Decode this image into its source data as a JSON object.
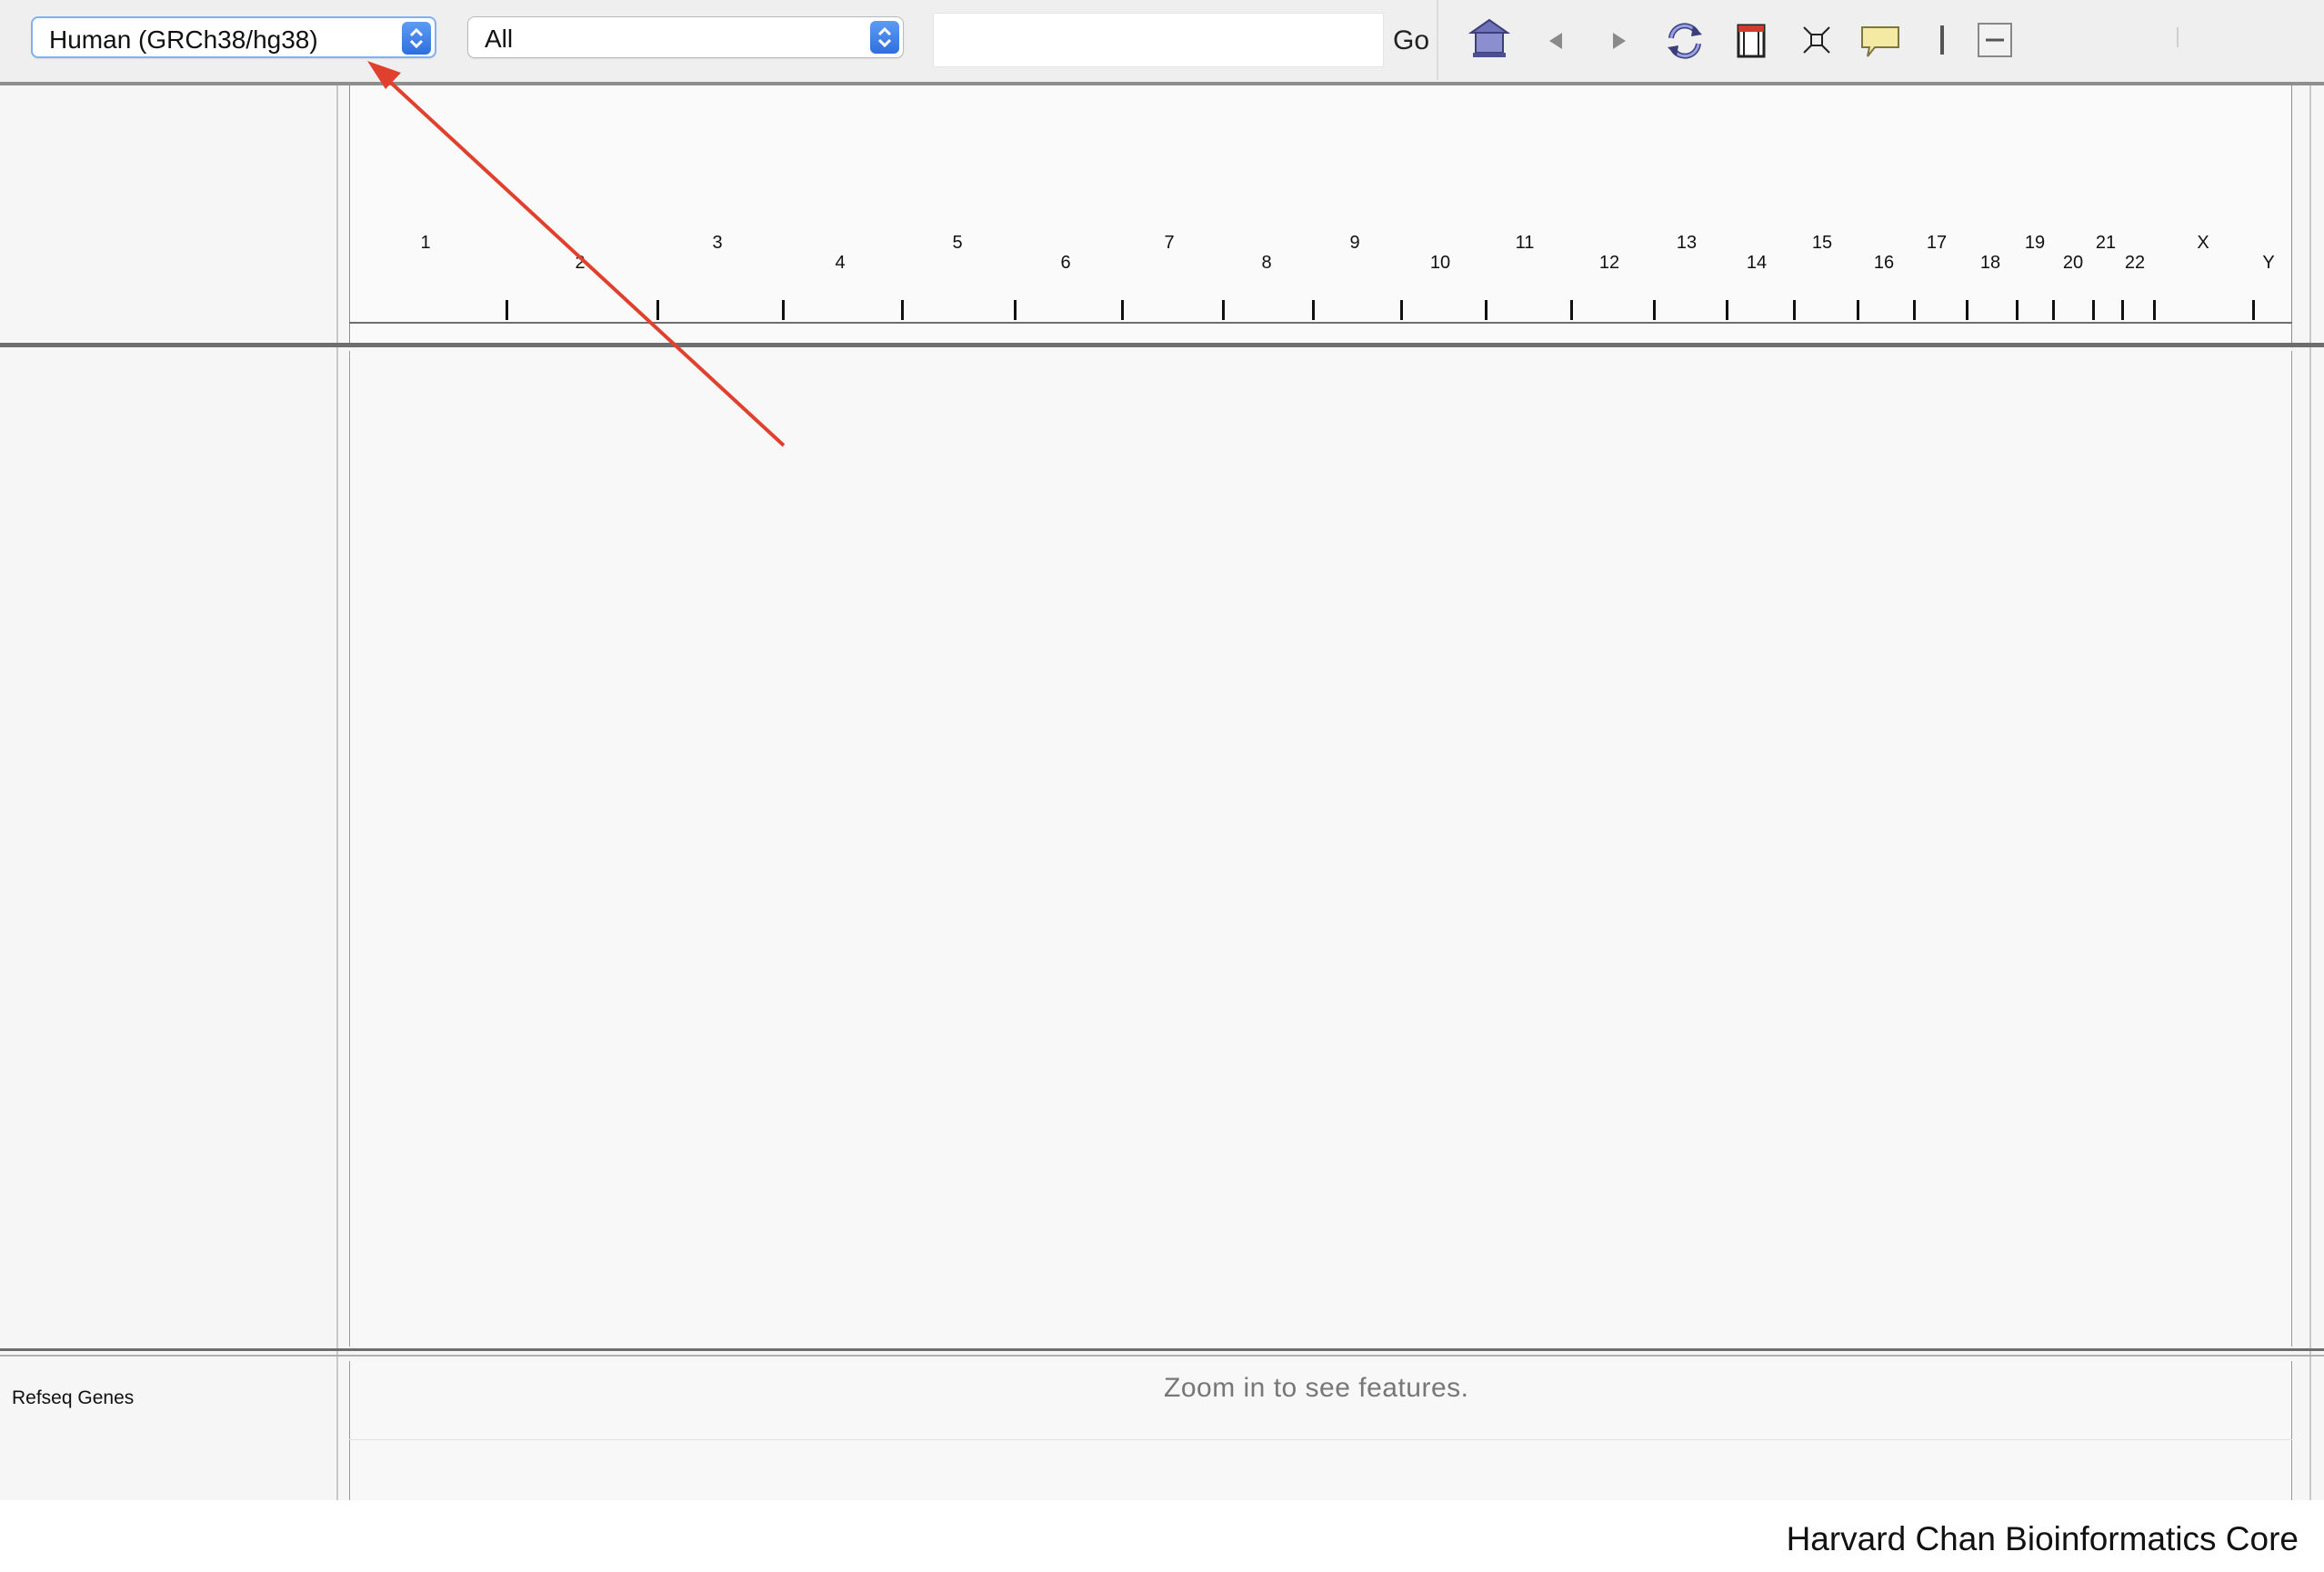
{
  "toolbar": {
    "genome_select": "Human (GRCh38/hg38)",
    "chromosome_select": "All",
    "locus_value": "",
    "go_label": "Go",
    "icons": [
      "home-icon",
      "back-icon",
      "forward-icon",
      "refresh-icon",
      "region-of-interest-icon",
      "fit-to-window-icon",
      "popup-info-icon",
      "ruler-toggle-icon",
      "zoom-out-icon"
    ]
  },
  "ruler": {
    "chromosomes_upper": [
      "1",
      "3",
      "5",
      "7",
      "9",
      "11",
      "13",
      "15",
      "17",
      "19",
      "21",
      "X"
    ],
    "chromosomes_lower": [
      "2",
      "4",
      "6",
      "8",
      "10",
      "12",
      "14",
      "16",
      "18",
      "20",
      "22",
      "Y"
    ]
  },
  "tracks": {
    "refseq_label": "Refseq Genes",
    "zoom_message": "Zoom in to see features."
  },
  "footer": {
    "credit": "Harvard Chan Bioinformatics Core"
  },
  "annotation": {
    "arrow_color": "#e0412f"
  }
}
